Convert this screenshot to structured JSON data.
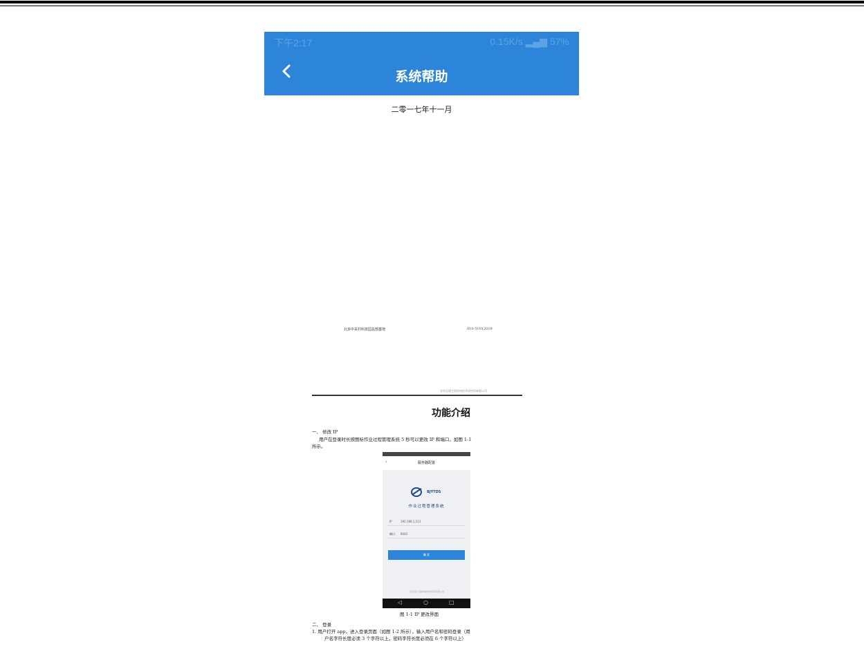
{
  "status_bar": {
    "time": "下午2:17",
    "network": "0.15K/s",
    "battery": "57%"
  },
  "header": {
    "title": "系统帮助",
    "back_icon": "chevron-left-icon"
  },
  "document": {
    "date_line": "二零一七年十一月",
    "footer_address": "北京中关村科技园总部基地",
    "footer_phone": "010-51012019",
    "company_header": "北京远通工程机电技术研究所有限公司",
    "section_title": "功能介绍",
    "item1_heading": "一、 修改 IP",
    "item1_line1": "用户在登录时长按图标作业过程管理系统 5 秒可以更改 IP 和端口，如图 1-1",
    "item1_line2": "所示。",
    "figure_caption": "图 1-1 IP 更改界面",
    "item2_heading": "二、 登录",
    "item2_line1": "1. 用户打开 app，进入登录页面（如图 1-2 所示），输入用户名和密码登录（用",
    "item2_line2": "户名字符长度必须 3 个字符以上，密码字符长度必须在 6 个字符以上）"
  },
  "figure": {
    "screen_title": "服务器配置",
    "logo_text": "BJYTDS",
    "system_name": "作业过程管理系统",
    "ip_label": "IP",
    "ip_value": "192.168.1.113",
    "port_label": "端口",
    "port_value": "8443",
    "confirm_label": "确 定",
    "footer": "北京远通工程机电技术研究所有限公司"
  },
  "colors": {
    "header_bg": "#2c85d8",
    "button_bg": "#2c85d8"
  }
}
